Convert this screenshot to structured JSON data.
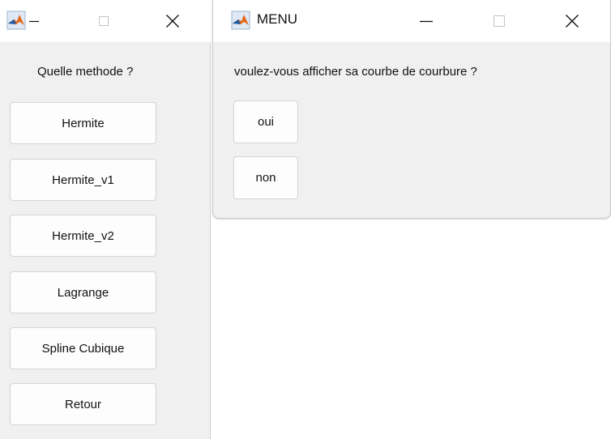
{
  "left_window": {
    "title": "",
    "minimize_icon": "minimize-icon",
    "maximize_icon": "maximize-icon",
    "close_icon": "close-icon",
    "prompt": "Quelle methode ?",
    "buttons": [
      {
        "label": "Hermite"
      },
      {
        "label": "Hermite_v1"
      },
      {
        "label": "Hermite_v2"
      },
      {
        "label": "Lagrange"
      },
      {
        "label": "Spline Cubique"
      },
      {
        "label": "Retour"
      }
    ]
  },
  "right_window": {
    "title": "MENU",
    "minimize_icon": "minimize-icon",
    "maximize_icon": "maximize-icon",
    "close_icon": "close-icon",
    "prompt": "voulez-vous afficher sa courbe de courbure ?",
    "buttons": [
      {
        "label": "oui"
      },
      {
        "label": "non"
      }
    ]
  },
  "colors": {
    "titlebar": "#ffffff",
    "window_body": "#f0f0f0",
    "button_face": "#fdfdfd",
    "button_border": "#d4d4d4",
    "matlab_icon_orange": "#e16a1c",
    "matlab_icon_blue": "#1f5aa6"
  }
}
